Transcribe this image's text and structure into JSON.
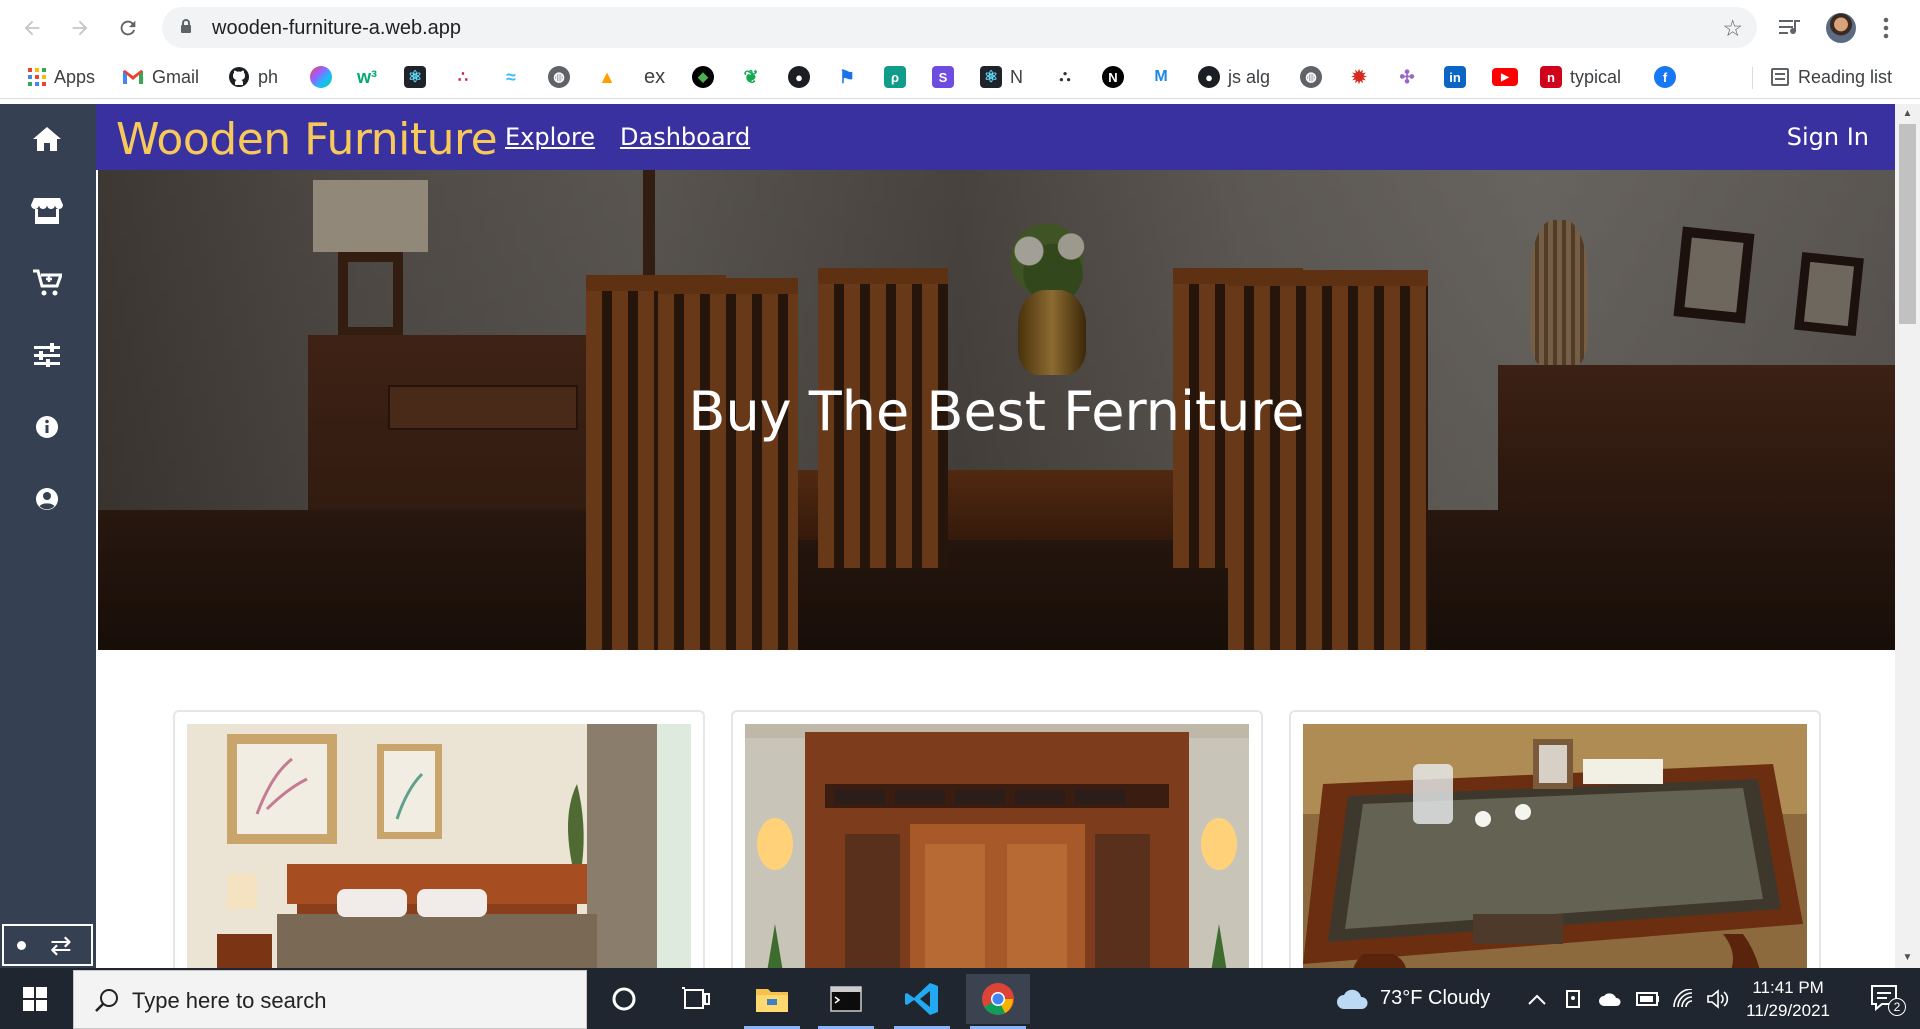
{
  "browser": {
    "url": "wooden-furniture-a.web.app",
    "bookmarks": [
      {
        "label": "Apps",
        "icon": "apps-grid-icon"
      },
      {
        "label": "Gmail",
        "icon": "gmail-icon"
      },
      {
        "label": "ph",
        "icon": "github-icon"
      },
      {
        "label": "",
        "icon": "figma-icon"
      },
      {
        "label": "",
        "icon": "w3schools-icon"
      },
      {
        "label": "",
        "icon": "react-icon"
      },
      {
        "label": "",
        "icon": "dots-icon"
      },
      {
        "label": "",
        "icon": "tailwind-icon"
      },
      {
        "label": "",
        "icon": "globe-icon"
      },
      {
        "label": "",
        "icon": "firebase-icon"
      },
      {
        "label": "ex",
        "icon": ""
      },
      {
        "label": "",
        "icon": "node-icon"
      },
      {
        "label": "",
        "icon": "mongodb-icon"
      },
      {
        "label": "",
        "icon": "github-icon"
      },
      {
        "label": "",
        "icon": "flag-icon"
      },
      {
        "label": "",
        "icon": "postgres-icon"
      },
      {
        "label": "",
        "icon": "stripe-icon"
      },
      {
        "label": "N",
        "icon": "react-icon"
      },
      {
        "label": "",
        "icon": "nestjs-icon"
      },
      {
        "label": "",
        "icon": "next-icon"
      },
      {
        "label": "",
        "icon": "mui-icon"
      },
      {
        "label": "js alg",
        "icon": "github-icon"
      },
      {
        "label": "",
        "icon": "globe-icon"
      },
      {
        "label": "",
        "icon": "maple-leaf-icon"
      },
      {
        "label": "",
        "icon": "graphql-icon"
      },
      {
        "label": "",
        "icon": "linkedin-icon"
      },
      {
        "label": "",
        "icon": "youtube-icon"
      },
      {
        "label": "typical",
        "icon": "typical-icon"
      },
      {
        "label": "",
        "icon": "facebook-icon"
      }
    ],
    "reading_list": "Reading list"
  },
  "site": {
    "brand": "Wooden Furniture",
    "nav": {
      "explore": "Explore",
      "dashboard": "Dashboard"
    },
    "sign_in": "Sign In",
    "hero_title": "Buy The Best Ferniture",
    "sidebar_icons": [
      "home-icon",
      "store-icon",
      "cart-icon",
      "sliders-icon",
      "info-icon",
      "user-circle-icon"
    ],
    "cards": [
      {
        "subject": "bedroom bed"
      },
      {
        "subject": "wooden door"
      },
      {
        "subject": "glass coffee table"
      }
    ]
  },
  "taskbar": {
    "search_placeholder": "Type here to search",
    "weather": "73°F  Cloudy",
    "time": "11:41 PM",
    "date": "11/29/2021",
    "notification_count": "2"
  }
}
